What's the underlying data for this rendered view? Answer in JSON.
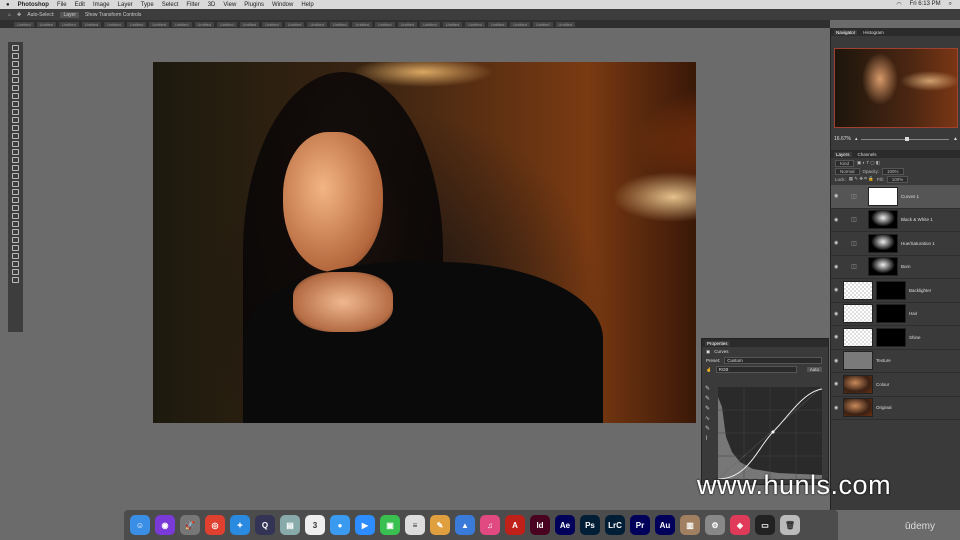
{
  "menubar": {
    "apple": "",
    "items": [
      "Photoshop",
      "File",
      "Edit",
      "Image",
      "Layer",
      "Type",
      "Select",
      "Filter",
      "3D",
      "View",
      "Plugins",
      "Window",
      "Help"
    ],
    "clock": "Fri 6:13 PM"
  },
  "options": {
    "auto_select": "Auto-Select:",
    "layer": "Layer",
    "transform": "Show Transform Controls"
  },
  "tabs": [
    "Untitled",
    "Untitled",
    "Untitled",
    "Untitled",
    "Untitled",
    "Untitled",
    "Untitled",
    "Untitled",
    "Untitled",
    "Untitled",
    "Untitled",
    "Untitled",
    "Untitled",
    "Untitled",
    "Untitled",
    "Untitled",
    "Untitled",
    "Untitled",
    "Untitled",
    "Untitled",
    "Untitled",
    "Untitled",
    "Untitled",
    "Untitled",
    "Untitled"
  ],
  "navigator": {
    "tabs": [
      "Navigator",
      "Histogram"
    ],
    "zoom": "16.67%"
  },
  "layers": {
    "tabs": [
      "Layers",
      "Channels"
    ],
    "kind": "Kind",
    "blend": "Normal",
    "opacity_label": "Opacity:",
    "opacity": "100%",
    "lock_label": "Lock:",
    "fill_label": "Fill:",
    "fill": "100%",
    "items": [
      {
        "name": "Curves 1",
        "type": "adj",
        "selected": true
      },
      {
        "name": "Black & White 1",
        "type": "adj"
      },
      {
        "name": "Hue/Saturation 1",
        "type": "adj"
      },
      {
        "name": "Burn",
        "type": "adj"
      },
      {
        "name": "Backlighter",
        "type": "pix"
      },
      {
        "name": "Hair",
        "type": "pix"
      },
      {
        "name": "Shine",
        "type": "pix"
      },
      {
        "name": "Texture",
        "type": "gray"
      },
      {
        "name": "Colour",
        "type": "photo"
      },
      {
        "name": "Original",
        "type": "photo"
      }
    ]
  },
  "properties": {
    "title": "Properties",
    "type": "Curves",
    "preset_label": "Preset:",
    "preset": "Custom",
    "channel": "RGB",
    "auto": "Auto"
  },
  "watermark": "www.hunls.com",
  "dock": [
    {
      "n": "finder",
      "t": "☺",
      "c": "#3a8ee6"
    },
    {
      "n": "siri",
      "t": "◉",
      "c": "#7a3ad8"
    },
    {
      "n": "launchpad",
      "t": "🚀",
      "c": "#777"
    },
    {
      "n": "chrome",
      "t": "◎",
      "c": "#e04030"
    },
    {
      "n": "safari",
      "t": "✦",
      "c": "#2a8ae0"
    },
    {
      "n": "quicktime",
      "t": "Q",
      "c": "#335"
    },
    {
      "n": "preview",
      "t": "▤",
      "c": "#8aa"
    },
    {
      "n": "calendar",
      "t": "3",
      "c": "#eee"
    },
    {
      "n": "messenger",
      "t": "●",
      "c": "#3a9af0"
    },
    {
      "n": "zoom",
      "t": "▶",
      "c": "#2d8cff"
    },
    {
      "n": "facetime",
      "t": "▣",
      "c": "#3ac050"
    },
    {
      "n": "textedit",
      "t": "≡",
      "c": "#ddd"
    },
    {
      "n": "pages",
      "t": "✎",
      "c": "#e0a040"
    },
    {
      "n": "keynote",
      "t": "▲",
      "c": "#3a7ad8"
    },
    {
      "n": "music",
      "t": "♫",
      "c": "#e04a80"
    },
    {
      "n": "acrobat",
      "t": "A",
      "c": "#c0201a"
    },
    {
      "n": "Id",
      "t": "Id",
      "c": "#49021f"
    },
    {
      "n": "Ae",
      "t": "Ae",
      "c": "#00005b"
    },
    {
      "n": "Ps",
      "t": "Ps",
      "c": "#001e36"
    },
    {
      "n": "LrC",
      "t": "LrC",
      "c": "#001e36"
    },
    {
      "n": "Pr",
      "t": "Pr",
      "c": "#00005b"
    },
    {
      "n": "Au",
      "t": "Au",
      "c": "#00005b"
    },
    {
      "n": "archive",
      "t": "▥",
      "c": "#a08060"
    },
    {
      "n": "system-preferences",
      "t": "⚙",
      "c": "#888"
    },
    {
      "n": "creative-cloud",
      "t": "◈",
      "c": "#e03a5a"
    },
    {
      "n": "screen",
      "t": "▭",
      "c": "#222"
    },
    {
      "n": "trash",
      "t": "🗑",
      "c": "#bbb"
    }
  ],
  "udemy": "ūdemy"
}
